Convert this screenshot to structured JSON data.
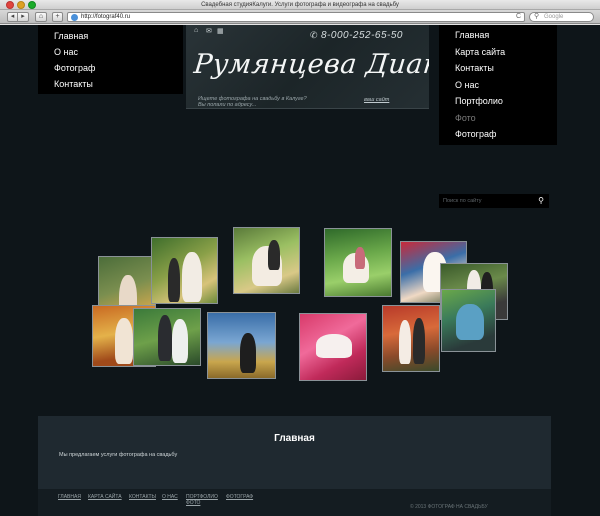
{
  "window": {
    "title": "Свадебная студияКалуги. Услуги фотографа и видеографа на свадьбу"
  },
  "toolbar": {
    "back": "◂",
    "forward": "▸",
    "home": "⌂",
    "add": "+",
    "url": "http://fotograf40.ru",
    "reload": "C",
    "search_placeholder": "Google"
  },
  "left_nav": {
    "items": [
      "Главная",
      "О нас",
      "Фотограф",
      "Контакты"
    ]
  },
  "banner": {
    "phone": "8-000-252-65-50",
    "brand": "Румянцева Диана",
    "subtitle_line1": "Ищете фотографа на свадьбу в Калуге?",
    "subtitle_line2": "Вы попали по адресу...",
    "link": "ваш сайт"
  },
  "right_nav": {
    "items": [
      "Главная",
      "Карта сайта",
      "Контакты",
      "О нас",
      "Портфолио",
      "Фото",
      "Фотограф"
    ]
  },
  "search": {
    "placeholder": "Поиск по сайту",
    "button_icon": "search-icon"
  },
  "footer": {
    "title": "Главная",
    "text": "Мы предлагаем услуги фотографа на свадьбу",
    "links": [
      "ГЛАВНАЯ",
      "КАРТА САЙТА",
      "КОНТАКТЫ",
      "О НАС",
      "ПОРТФОЛИО",
      "ФОТОГРАФ"
    ],
    "links_extra": "ФОТО",
    "copyright": "© 2013 ФОТОГРАФ НА СВАДЬБУ"
  },
  "colors": {
    "page_bg": "#0e1519",
    "nav_bg": "#000000",
    "footer_bg": "#1f2930"
  }
}
